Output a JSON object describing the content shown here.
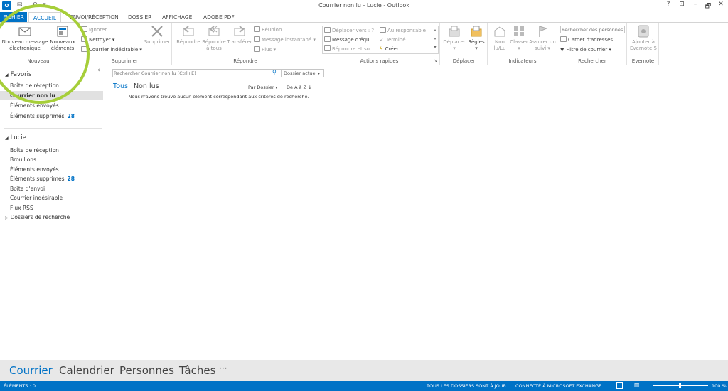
{
  "window": {
    "title": "Courrier non lu - Lucie - Outlook",
    "help_label": "?",
    "restore_ribbon_label": "⊡",
    "minimize_label": "–",
    "maximize_label": "🗗",
    "close_label": "✕"
  },
  "tabs": [
    {
      "label": "FICHIER"
    },
    {
      "label": "ACCUEIL"
    },
    {
      "label": "ENVOI/RÉCEPTION"
    },
    {
      "label": "DOSSIER"
    },
    {
      "label": "AFFICHAGE"
    },
    {
      "label": "ADOBE PDF"
    }
  ],
  "ribbon": {
    "nouveau": {
      "group_label": "Nouveau",
      "new_message": "Nouveau message électronique",
      "new_items": "Nouveaux éléments"
    },
    "supprimer": {
      "group_label": "Supprimer",
      "ignorer": "Ignorer",
      "nettoyer": "Nettoyer",
      "courrier_indesirable": "Courrier indésirable",
      "supprimer": "Supprimer"
    },
    "repondre": {
      "group_label": "Répondre",
      "repondre": "Répondre",
      "repondre_tous_1": "Répondre",
      "repondre_tous_2": "à tous",
      "transferer": "Transférer",
      "reunion": "Réunion",
      "message_instantane": "Message instantané",
      "plus": "Plus"
    },
    "actions_rapides": {
      "group_label": "Actions rapides",
      "items": [
        "Déplacer vers : ?",
        "Message d'équi...",
        "Répondre et su...",
        "Au responsable",
        "Terminé",
        "Créer"
      ]
    },
    "deplacer": {
      "group_label": "Déplacer",
      "deplacer": "Déplacer",
      "regles": "Règles"
    },
    "indicateurs": {
      "group_label": "Indicateurs",
      "non_lu_1": "Non",
      "non_lu_2": "lu/Lu",
      "classer": "Classer",
      "assurer_suivi_1": "Assurer un",
      "assurer_suivi_2": "suivi"
    },
    "rechercher": {
      "group_label": "Rechercher",
      "search_people_placeholder": "Rechercher des personnes",
      "carnet": "Carnet d'adresses",
      "filtre": "Filtre de courrier"
    },
    "evernote": {
      "group_label": "Evernote",
      "ajouter_1": "Ajouter à",
      "ajouter_2": "Evernote 5"
    }
  },
  "folder_pane": {
    "collapse_label": "‹",
    "favoris": {
      "label": "Favoris",
      "items": [
        {
          "label": "Boîte de réception",
          "count": ""
        },
        {
          "label": "Courrier non lu",
          "count": ""
        },
        {
          "label": "Éléments envoyés",
          "count": ""
        },
        {
          "label": "Éléments supprimés",
          "count": "28"
        }
      ]
    },
    "account": {
      "label": "Lucie",
      "items": [
        {
          "label": "Boîte de réception",
          "count": ""
        },
        {
          "label": "Brouillons",
          "count": ""
        },
        {
          "label": "Éléments envoyés",
          "count": ""
        },
        {
          "label": "Éléments supprimés",
          "count": "28"
        },
        {
          "label": "Boîte d'envoi",
          "count": ""
        },
        {
          "label": "Courrier indésirable",
          "count": ""
        },
        {
          "label": "Flux RSS",
          "count": ""
        },
        {
          "label": "Dossiers de recherche",
          "count": ""
        }
      ]
    }
  },
  "message_list": {
    "search_placeholder": "Rechercher Courrier non lu (Ctrl+E)",
    "search_scope": "Dossier actuel",
    "filter_all": "Tous",
    "filter_unread": "Non lus",
    "sort_by": "Par Dossier",
    "sort_order": "De A à Z",
    "empty_message": "Nous n'avons trouvé aucun élément correspondant aux critères de recherche."
  },
  "navbar": {
    "items": [
      "Courrier",
      "Calendrier",
      "Personnes",
      "Tâches"
    ],
    "more": "···"
  },
  "status": {
    "elements": "ÉLÉMENTS : 0",
    "sync": "TOUS LES DOSSIERS SONT À JOUR.",
    "connection": "CONNECTÉ À MICROSOFT EXCHANGE",
    "zoom": "100 %"
  },
  "colors": {
    "accent": "#0072c6",
    "annotation": "#a6ce39"
  }
}
